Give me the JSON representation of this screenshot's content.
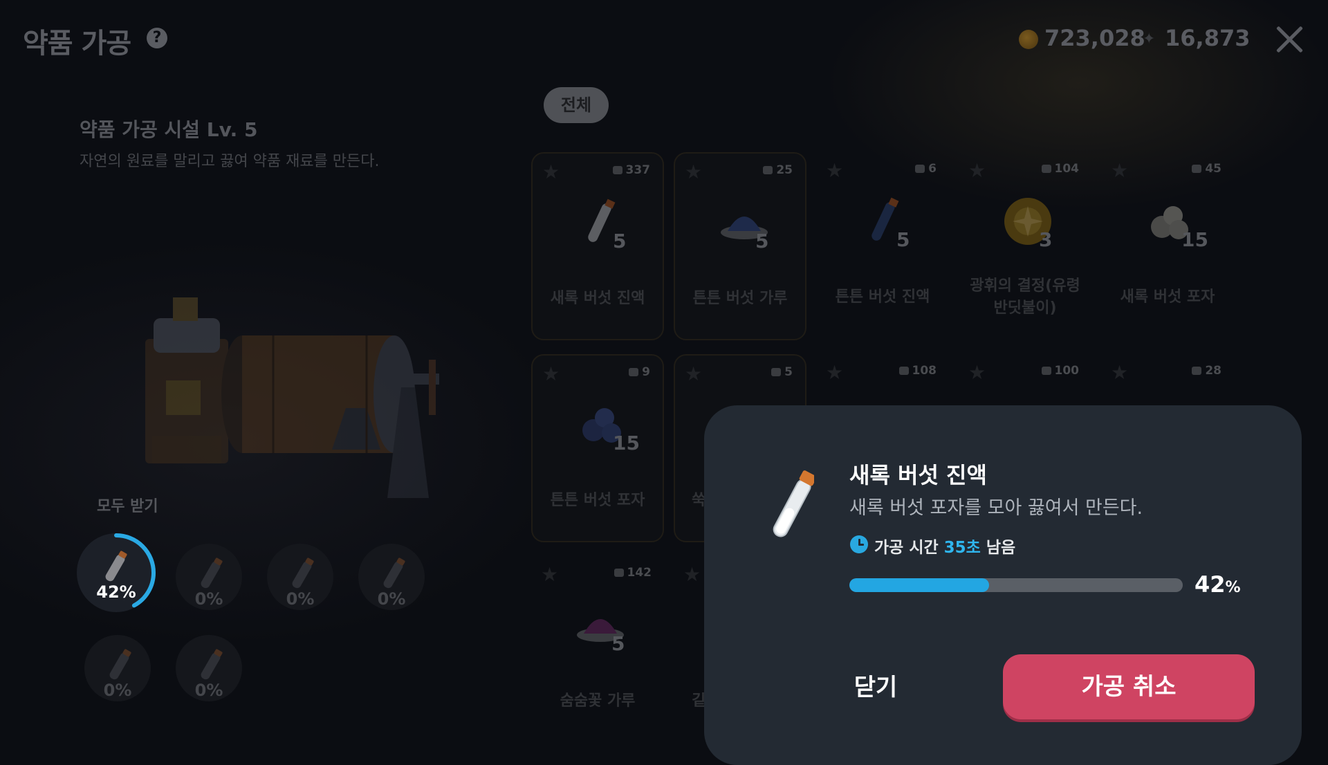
{
  "header": {
    "title": "약품 가공",
    "help_icon": "question-circle-icon",
    "gold": "723,028",
    "gems": "16,873"
  },
  "facility": {
    "title": "약품 가공 시설 Lv. 5",
    "description": "자연의 원료를 말리고 끓여 약품 재료를 만든다."
  },
  "slots": {
    "collect_all": "모두 받기",
    "items": [
      {
        "percent": "42%",
        "progress": 0.42,
        "active": true
      },
      {
        "percent": "0%",
        "progress": 0
      },
      {
        "percent": "0%",
        "progress": 0
      },
      {
        "percent": "0%",
        "progress": 0
      },
      {
        "percent": "0%",
        "progress": 0
      },
      {
        "percent": "0%",
        "progress": 0
      }
    ]
  },
  "filter": {
    "all_label": "전체"
  },
  "items": [
    {
      "qty": "337",
      "count": "5",
      "name": "새록 버섯 진액",
      "art": "vial-icon"
    },
    {
      "qty": "25",
      "count": "5",
      "name": "튼튼 버섯 가루",
      "art": "powder-dark-icon"
    },
    {
      "qty": "6",
      "count": "5",
      "name": "튼튼 버섯 진액",
      "art": "vial-dark-icon"
    },
    {
      "qty": "104",
      "count": "3",
      "name": "광휘의 결정(유령 반딧불이)",
      "art": "crystal-icon"
    },
    {
      "qty": "45",
      "count": "15",
      "name": "새록 버섯 포자",
      "art": "spore-icon"
    },
    {
      "qty": "9",
      "count": "15",
      "name": "튼튼 버섯 포자",
      "art": "spore-blue-icon"
    },
    {
      "qty": "5",
      "count": "",
      "name": "쑥",
      "art": ""
    },
    {
      "qty": "108",
      "count": "",
      "name": "",
      "art": ""
    },
    {
      "qty": "100",
      "count": "",
      "name": "",
      "art": ""
    },
    {
      "qty": "28",
      "count": "",
      "name": "",
      "art": ""
    },
    {
      "qty": "142",
      "count": "5",
      "name": "숨숨꽃 가루",
      "art": "powder-purple-icon"
    },
    {
      "qty": "",
      "count": "",
      "name": "깉",
      "art": ""
    }
  ],
  "popup": {
    "title": "새록 버섯 진액",
    "description": "새록 버섯 포자를 모아 끓여서 만든다.",
    "time_prefix": "가공 시간 ",
    "time_value": "35초",
    "time_suffix": " 남음",
    "progress": 0.42,
    "percent_num": "42",
    "percent_sign": "%",
    "close_label": "닫기",
    "cancel_label": "가공 취소"
  }
}
